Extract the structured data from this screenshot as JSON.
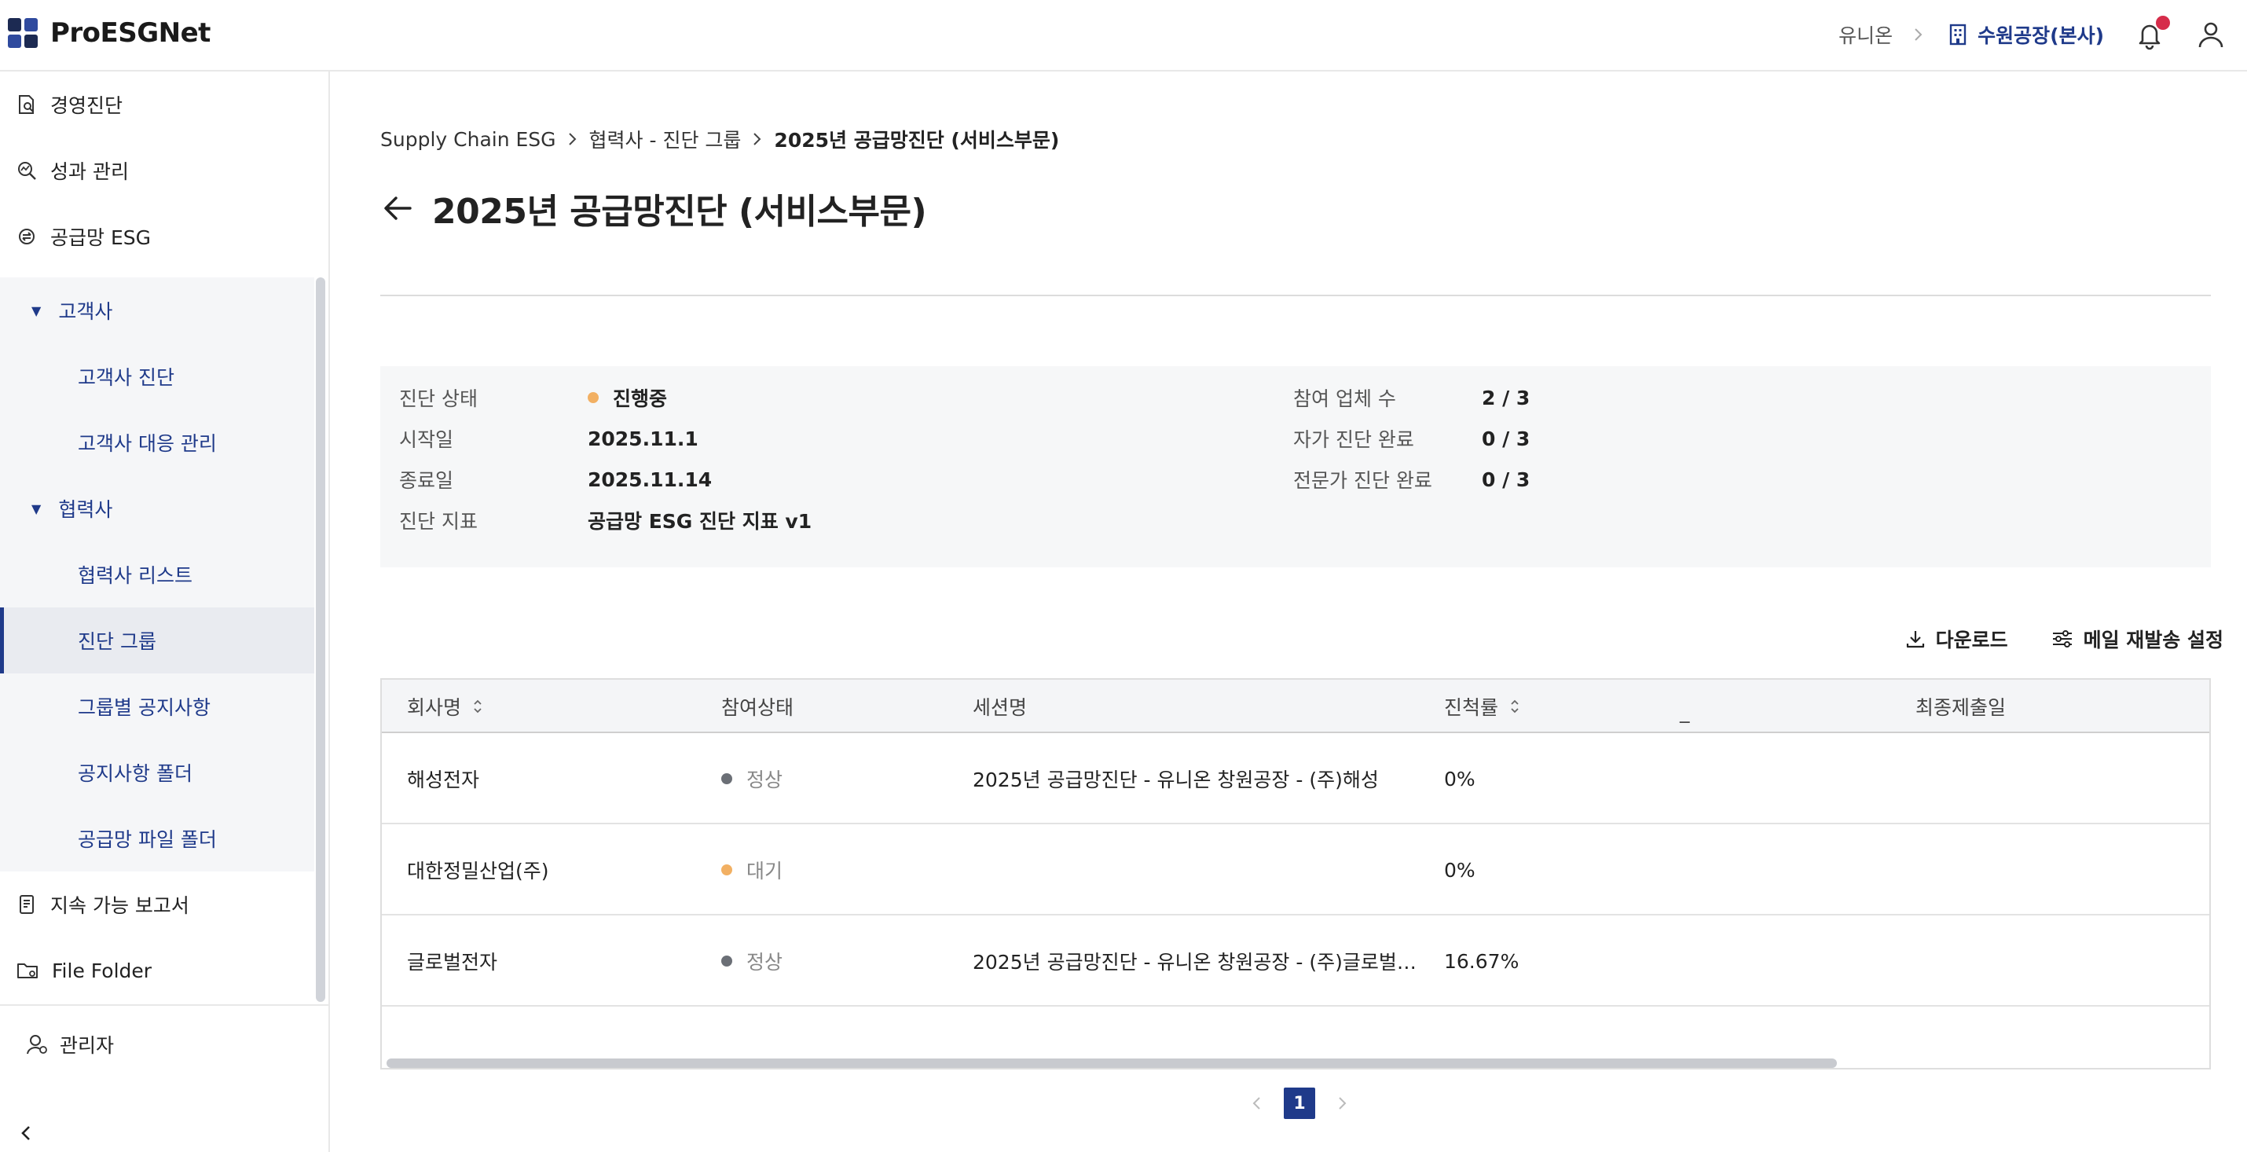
{
  "app": {
    "name": "ProESGNet"
  },
  "header": {
    "org": "유니온",
    "site": "수원공장(본사)",
    "notification_dot_color": "#d62c4a"
  },
  "sidebar": {
    "items": [
      {
        "label": "경영진단",
        "icon": "document-search-icon"
      },
      {
        "label": "성과 관리",
        "icon": "chart-search-icon"
      },
      {
        "label": "공급망 ESG",
        "icon": "supply-chain-icon"
      }
    ],
    "groups": [
      {
        "label": "고객사",
        "expanded": true,
        "children": [
          "고객사 진단",
          "고객사 대응 관리"
        ]
      },
      {
        "label": "협력사",
        "expanded": true,
        "children": [
          "협력사 리스트",
          "진단 그룹",
          "그룹별 공지사항",
          "공지사항 폴더",
          "공급망 파일 폴더"
        ]
      }
    ],
    "active_item": "진단 그룹",
    "bottom_items": [
      {
        "label": "지속 가능 보고서",
        "icon": "report-icon"
      },
      {
        "label": "File Folder",
        "icon": "folder-icon"
      }
    ],
    "admin_label": "관리자"
  },
  "breadcrumb": [
    "Supply Chain ESG",
    "협력사 - 진단 그룹",
    "2025년 공급망진단 (서비스부문)"
  ],
  "page_title": "2025년 공급망진단 (서비스부문)",
  "info": {
    "status_label": "진단 상태",
    "status_value": "진행중",
    "status_color": "#f2b063",
    "start_label": "시작일",
    "start_value": "2025.11.1",
    "end_label": "종료일",
    "end_value": "2025.11.14",
    "index_label": "진단 지표",
    "index_value": "공급망 ESG 진단 지표 v1",
    "participants_label": "참여 업체 수",
    "participants_value": "2 / 3",
    "self_label": "자가 진단 완료",
    "self_value": "0 / 3",
    "expert_label": "전문가 진단 완료",
    "expert_value": "0 / 3"
  },
  "actions": {
    "download": "다운로드",
    "mail": "메일 재발송 설정"
  },
  "table": {
    "headers": {
      "company": "회사명",
      "status": "참여상태",
      "session": "세션명",
      "progress": "진척률",
      "blank": "_",
      "last_submit": "최종제출일"
    },
    "rows": [
      {
        "company": "해성전자",
        "status": "정상",
        "status_color": "#6b6f76",
        "session": "2025년 공급망진단 - 유니온 창원공장 - (주)해성",
        "progress": "0%",
        "last_submit": ""
      },
      {
        "company": "대한정밀산업(주)",
        "status": "대기",
        "status_color": "#f2b063",
        "session": "",
        "progress": "0%",
        "last_submit": ""
      },
      {
        "company": "글로벌전자",
        "status": "정상",
        "status_color": "#6b6f76",
        "session": "2025년 공급망진단 - 유니온 창원공장 - (주)글로벌…",
        "progress": "16.67%",
        "last_submit": ""
      }
    ]
  },
  "pagination": {
    "current": "1"
  }
}
